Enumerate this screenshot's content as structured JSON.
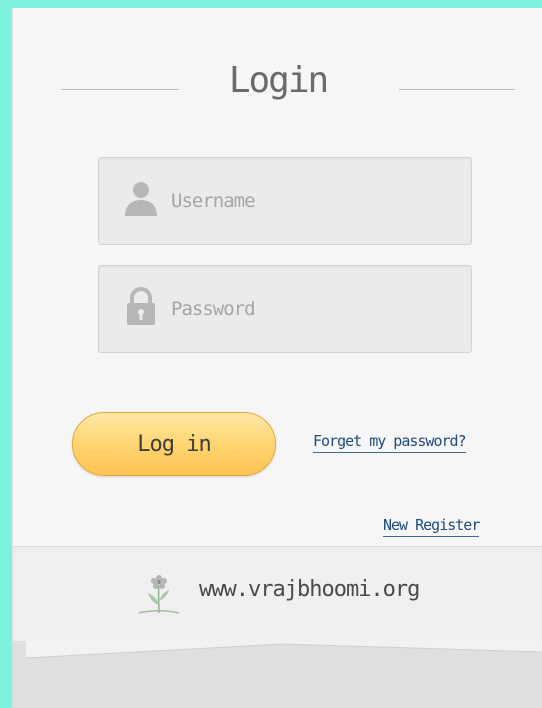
{
  "login": {
    "title": "Login",
    "username_placeholder": "Username",
    "password_placeholder": "Password",
    "login_button_label": "Log in",
    "forgot_password_link": "Forget my password?",
    "new_register_link": "New Register"
  },
  "footer": {
    "website": "www.vrajbhoomi.org",
    "logo_icon": "flower-icon"
  },
  "icons": {
    "username": "user-icon",
    "password": "lock-icon"
  },
  "colors": {
    "page_background": "#7ff2dc",
    "card_background": "#f6f6f6",
    "login_button": "#ffd36e",
    "link": "#1f4d7a"
  }
}
